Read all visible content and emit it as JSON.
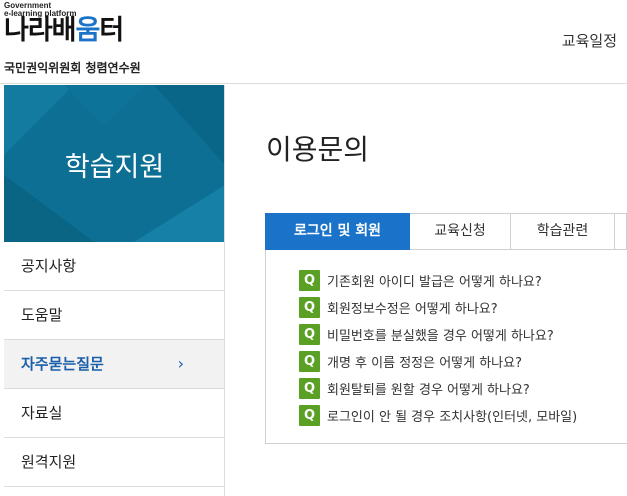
{
  "header": {
    "logo_small_line1": "Government",
    "logo_small_line2": "e-learning platform",
    "logo_main_a": "나라배",
    "logo_main_b": "움",
    "logo_main_c": "터",
    "org": "국민권익위원회 청렴연수원",
    "nav_item": "교육일정"
  },
  "sidebar": {
    "banner_title": "학습지원",
    "items": [
      {
        "label": "공지사항"
      },
      {
        "label": "도움말"
      },
      {
        "label": "자주묻는질문",
        "chevron": "›"
      },
      {
        "label": "자료실"
      },
      {
        "label": "원격지원"
      }
    ]
  },
  "main": {
    "title": "이용문의",
    "tabs": [
      {
        "label": "로그인 및 회원"
      },
      {
        "label": "교육신청"
      },
      {
        "label": "학습관련"
      },
      {
        "label": ""
      }
    ],
    "q_label": "Q",
    "questions": [
      "기존회원 아이디 발급은 어떻게 하나요?",
      "회원정보수정은 어떻게 하나요?",
      "비밀번호를 분실했을 경우 어떻게 하나요?",
      "개명 후 이름 정정은 어떻게 하나요?",
      "회원탈퇴를 원할 경우 어떻게 하나요?",
      "로그인이 안 될 경우 조치사항(인터넷, 모바일)"
    ]
  },
  "colors": {
    "brand_blue": "#1a73c8",
    "banner_teal": "#0c6f93",
    "q_green": "#5aa024",
    "active_text": "#1a5fa8"
  }
}
